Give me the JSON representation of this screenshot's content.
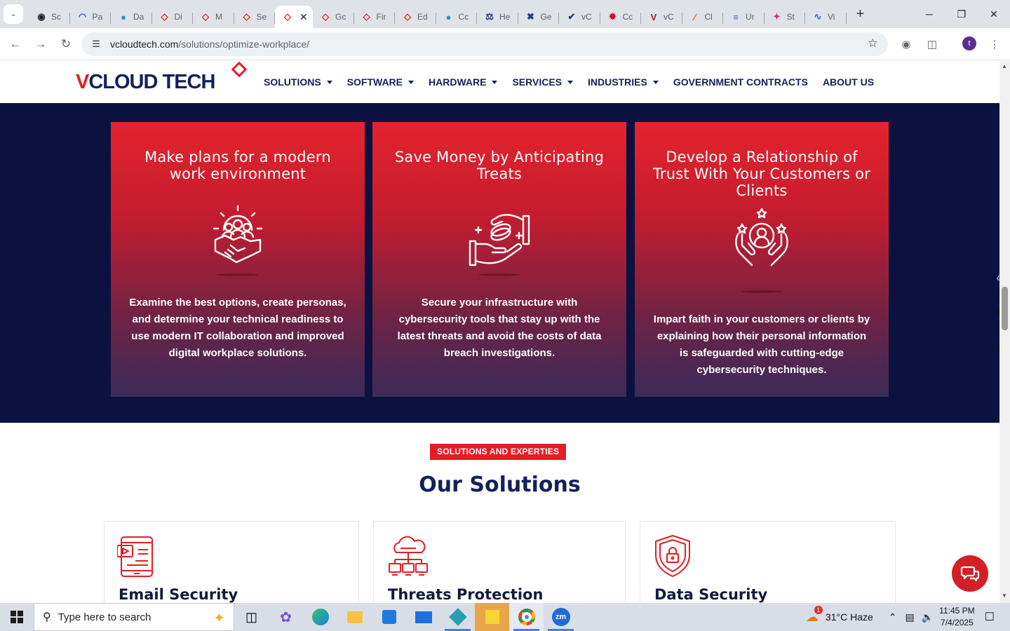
{
  "browser": {
    "tabs": [
      {
        "label": "Sc",
        "color": "#202124",
        "glyph": "◉"
      },
      {
        "label": "Pa",
        "color": "#1e5fbf",
        "glyph": "◠"
      },
      {
        "label": "Da",
        "color": "#1a9bb0",
        "glyph": "●"
      },
      {
        "label": "Di",
        "color": "#e31e24",
        "glyph": "◇"
      },
      {
        "label": "M",
        "color": "#e31e24",
        "glyph": "◇"
      },
      {
        "label": "Se",
        "color": "#e31e24",
        "glyph": "◇"
      },
      {
        "label": "",
        "color": "#e31e24",
        "glyph": "◇",
        "active": true
      },
      {
        "label": "Gc",
        "color": "#e31e24",
        "glyph": "◇"
      },
      {
        "label": "Fir",
        "color": "#e31e24",
        "glyph": "◇"
      },
      {
        "label": "Ed",
        "color": "#e31e24",
        "glyph": "◇"
      },
      {
        "label": "Cc",
        "color": "#1a9bb0",
        "glyph": "●"
      },
      {
        "label": "He",
        "color": "#1e3a8a",
        "glyph": "⚖"
      },
      {
        "label": "Ge",
        "color": "#1e3a8a",
        "glyph": "✖"
      },
      {
        "label": "vC",
        "color": "#1e3a8a",
        "glyph": "✔"
      },
      {
        "label": "Cc",
        "color": "#c8102e",
        "glyph": "✹"
      },
      {
        "label": "vC",
        "color": "#b0102a",
        "glyph": "V"
      },
      {
        "label": "Cl",
        "color": "#e8590c",
        "glyph": "∕"
      },
      {
        "label": "Ur",
        "color": "#3b6fd1",
        "glyph": "≡"
      },
      {
        "label": "St",
        "color": "#d6338c",
        "glyph": "✦"
      },
      {
        "label": "Vi",
        "color": "#2563eb",
        "glyph": "∿"
      }
    ],
    "active_tab_close": "✕",
    "new_tab": "+",
    "tab_menu_icon": "⌄",
    "window_controls": {
      "minimize": "─",
      "restore": "❐",
      "close": "✕"
    },
    "url_domain": "vcloudtech.com",
    "url_path": "/solutions/optimize-workplace/",
    "profile_initial": "t"
  },
  "site": {
    "logo_v": "V",
    "logo_rest": "CLOUD TECH",
    "menu": [
      {
        "label": "SOLUTIONS",
        "dropdown": true
      },
      {
        "label": "SOFTWARE",
        "dropdown": true
      },
      {
        "label": "HARDWARE",
        "dropdown": true
      },
      {
        "label": "SERVICES",
        "dropdown": true
      },
      {
        "label": "INDUSTRIES",
        "dropdown": true
      },
      {
        "label": "GOVERNMENT CONTRACTS",
        "dropdown": false
      },
      {
        "label": "ABOUT US",
        "dropdown": false
      }
    ],
    "cards": [
      {
        "title": "Make plans for a modern work environment",
        "icon": "team-handshake-gear-icon",
        "text": "Examine the best options, create personas, and determine your technical readiness to use modern IT collaboration and improved digital workplace solutions."
      },
      {
        "title": "Save Money by Anticipating Treats",
        "icon": "hands-coins-icon",
        "text": "Secure your infrastructure with cybersecurity tools that stay up with the latest threats and avoid the costs of data breach investigations."
      },
      {
        "title": "Develop a Relationship of Trust With Your Customers or Clients",
        "icon": "hands-customer-stars-icon",
        "text": "Impart faith in your customers or clients by explaining how their personal information is safeguarded with cutting-edge cybersecurity techniques."
      }
    ],
    "badge": "SOLUTIONS AND EXPERTIES",
    "section_title": "Our Solutions",
    "solutions": [
      {
        "title": "Email Security",
        "icon": "mobile-email-icon"
      },
      {
        "title": "Threats Protection",
        "icon": "cloud-network-icon"
      },
      {
        "title": "Data Security",
        "icon": "shield-lock-icon"
      }
    ]
  },
  "taskbar": {
    "search_placeholder": "Type here to search",
    "weather": "31°C  Haze",
    "weather_badge": "1",
    "time": "11:45 PM",
    "date": "7/4/2025"
  },
  "colors": {
    "brand_red": "#e31e24",
    "brand_navy": "#13215a",
    "band_navy": "#0c1240"
  }
}
